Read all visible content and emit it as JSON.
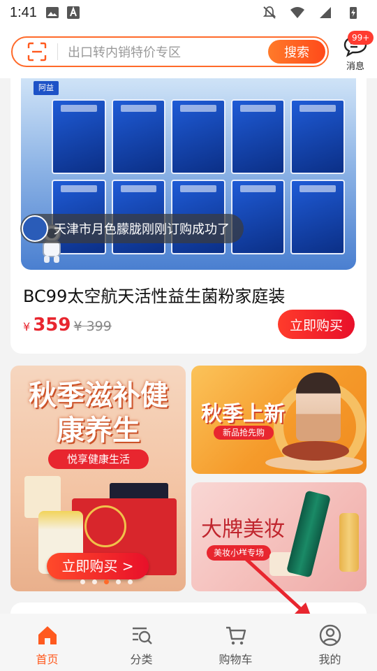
{
  "status_bar": {
    "time": "1:41"
  },
  "search": {
    "placeholder": "出口转内销特价专区",
    "button": "搜索"
  },
  "messages": {
    "badge": "99+",
    "label": "消息"
  },
  "product": {
    "image_brand": "阿益",
    "toast": "天津市月色朦胧刚刚订购成功了",
    "title": "BC99太空航天活性益生菌粉家庭装",
    "currency": "¥",
    "price": "359",
    "original_price": "¥ 399",
    "buy_label": "立即购买"
  },
  "banners": {
    "left": {
      "title": "秋季滋补健康养生",
      "subtitle": "悦享健康生活",
      "button": "立即购买 >"
    },
    "right_top": {
      "title": "秋季上新",
      "chip": "新品抢先购"
    },
    "right_bottom": {
      "title": "大牌美妆",
      "chip": "美妆小样专场"
    }
  },
  "tabbar": {
    "items": [
      {
        "label": "首页",
        "icon": "home-icon",
        "active": true
      },
      {
        "label": "分类",
        "icon": "category-search-icon",
        "active": false
      },
      {
        "label": "购物车",
        "icon": "cart-icon",
        "active": false
      },
      {
        "label": "我的",
        "icon": "profile-icon",
        "active": false
      }
    ]
  },
  "colors": {
    "accent": "#ff5a1f",
    "price": "#e8262f",
    "annotation_arrow": "#e8262f"
  }
}
